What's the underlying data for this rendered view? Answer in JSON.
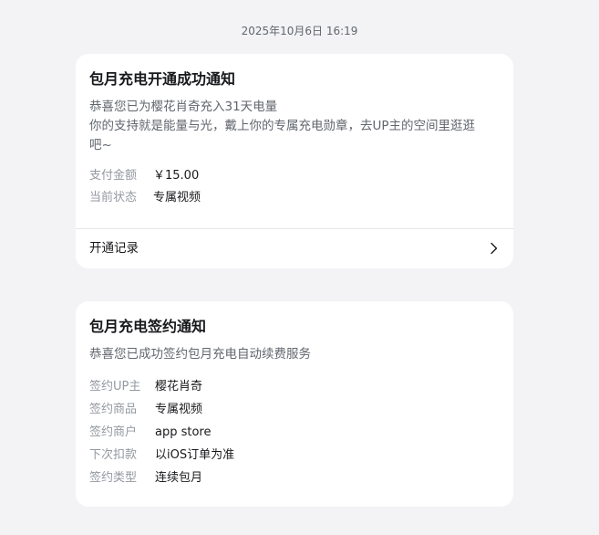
{
  "timestamp": "2025年10月6日 16:19",
  "notice1": {
    "title": "包月充电开通成功通知",
    "desc_line1": "恭喜您已为樱花肖奇充入31天电量",
    "desc_line2": "你的支持就是能量与光，戴上你的专属充电勋章，去UP主的空间里逛逛",
    "desc_line3": "吧~",
    "rows": [
      {
        "key": "支付金额",
        "value": "￥15.00"
      },
      {
        "key": "当前状态",
        "value": "专属视频"
      }
    ],
    "record_label": "开通记录",
    "record_icon": "chevron-right-icon"
  },
  "notice2": {
    "title": "包月充电签约通知",
    "desc": "恭喜您已成功签约包月充电自动续费服务",
    "rows": [
      {
        "key": "签约UP主",
        "value": "樱花肖奇"
      },
      {
        "key": "签约商品",
        "value": "专属视频"
      },
      {
        "key": "签约商户",
        "value": "app store"
      },
      {
        "key": "下次扣款",
        "value": "以iOS订单为准"
      },
      {
        "key": "签约类型",
        "value": "连续包月"
      }
    ]
  }
}
